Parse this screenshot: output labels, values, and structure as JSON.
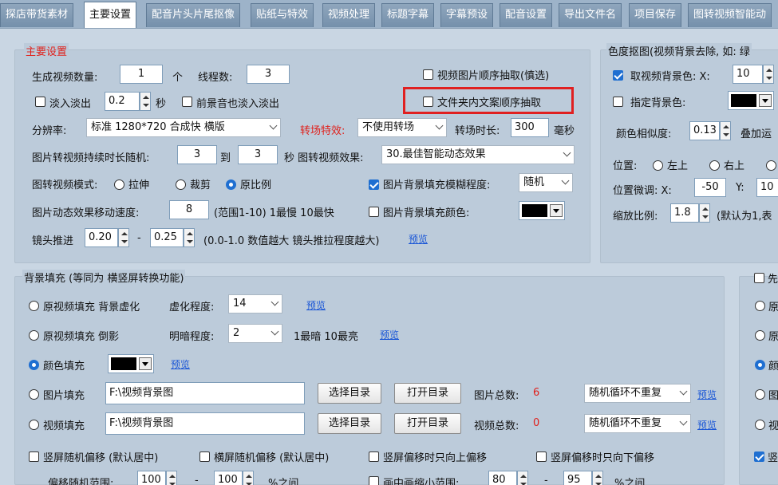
{
  "tabs": [
    "探店带货素材",
    "主要设置",
    "配音片头片尾抠像",
    "贴纸与特效",
    "视频处理",
    "标题字幕",
    "字幕预设",
    "配音设置",
    "导出文件名",
    "项目保存",
    "图转视频智能动"
  ],
  "main": {
    "title": "主要设置",
    "gen_count_label": "生成视频数量:",
    "gen_count": "1",
    "unit_ge": "个",
    "threads_label": "线程数:",
    "threads": "3",
    "img_seq_label": "视频图片顺序抽取(慎选)",
    "fade_label": "淡入淡出",
    "fade_val": "0.2",
    "sec": "秒",
    "fg_fade_label": "前景音也淡入淡出",
    "file_seq_label": "文件夹内文案顺序抽取",
    "res_label": "分辨率:",
    "res_val": "标准 1280*720 合成快 横版",
    "trans_label": "转场特效:",
    "trans_val": "不使用转场",
    "trans_dur_label": "转场时长:",
    "trans_dur": "300",
    "ms": "毫秒",
    "img_dur_label": "图片转视频持续时长随机:",
    "img_dur_from": "3",
    "to": "到",
    "img_dur_to": "3",
    "img_effect_label": "秒 图转视频效果:",
    "img_effect_val": "30.最佳智能动态效果",
    "mode_label": "图转视频模式:",
    "mode_stretch": "拉伸",
    "mode_crop": "裁剪",
    "mode_orig": "原比例",
    "blur_label": "图片背景填充模糊程度:",
    "blur_val": "随机",
    "speed_label": "图片动态效果移动速度:",
    "speed_val": "8",
    "speed_hint": "(范围1-10)  1最慢  10最快",
    "bgcolor_label": "图片背景填充颜色:",
    "zoom_label": "镜头推进",
    "zoom_from": "0.20",
    "dash": "-",
    "zoom_to": "0.25",
    "zoom_hint": "(0.0-1.0 数值越大 镜头推拉程度越大)",
    "preview": "预览"
  },
  "chroma": {
    "title": "色度抠图(视频背景去除, 如: 绿",
    "take_bg_label": "取视频背景色: X:",
    "take_x": "10",
    "specify_label": "指定背景色:",
    "similarity_label": "颜色相似度:",
    "similarity": "0.13",
    "overlay_label": "叠加运",
    "pos_label": "位置:",
    "pos_tl": "左上",
    "pos_tr": "右上",
    "fine_label": "位置微调:  X:",
    "fine_x": "-50",
    "y_label": "Y:",
    "fine_y": "10",
    "scale_label": "缩放比例:",
    "scale": "1.8",
    "scale_hint": "(默认为1,表"
  },
  "bgfill": {
    "title": "背景填充 (等同为 横竖屏转换功能)",
    "opt1": "原视频填充 背景虚化",
    "blur_deg_label": "虚化程度:",
    "blur_deg": "14",
    "opt2": "原视频填充 倒影",
    "dark_label": "明暗程度:",
    "dark": "2",
    "dark_hint": "1最暗  10最亮",
    "opt3": "颜色填充",
    "opt4": "图片填充",
    "img_path": "F:\\视频背景图",
    "choose_dir": "选择目录",
    "open_dir": "打开目录",
    "img_total_label": "图片总数:",
    "img_total": "6",
    "loop_val": "随机循环不重复",
    "opt5": "视频填充",
    "vid_path": "F:\\视频背景图",
    "vid_total_label": "视频总数:",
    "vid_total": "0",
    "vrand_label": "竖屏随机偏移 (默认居中)",
    "hrand_label": "横屏随机偏移 (默认居中)",
    "vup_label": "竖屏偏移时只向上偏移",
    "vdown_label": "竖屏偏移时只向下偏移",
    "offset_label": "偏移随机范围:",
    "offset_from": "100",
    "offset_to": "100",
    "percent_between": "%之间",
    "pip_label": "画中画缩小范围:",
    "pip_from": "80",
    "pip_to": "95",
    "percent_between2": "%之间"
  },
  "right2": {
    "first_label": "先",
    "r1": "原",
    "r2": "原",
    "r3": "颜",
    "r4": "图",
    "r5": "视",
    "r6": "竖"
  }
}
